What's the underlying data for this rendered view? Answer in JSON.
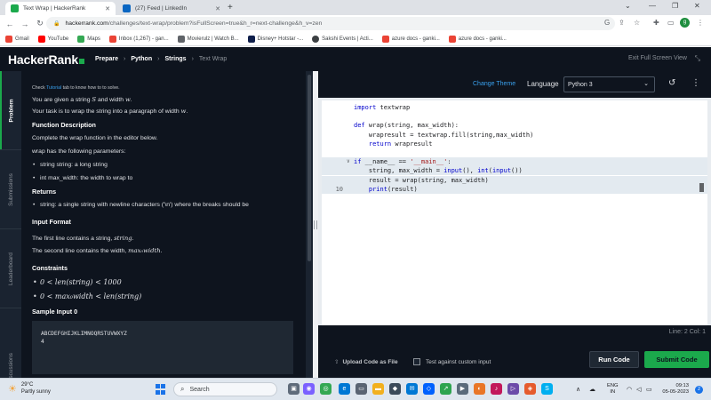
{
  "browser": {
    "tabs": [
      {
        "label": "Text Wrap | HackerRank",
        "active": true,
        "favicon_color": "#1ba94c"
      },
      {
        "label": "(27) Feed | LinkedIn",
        "active": false,
        "favicon_color": "#0a66c2"
      }
    ],
    "new_tab": "+",
    "url_host": "hackerrank.com",
    "url_path": "/challenges/text-wrap/problem?isFullScreen=true&h_r=next-challenge&h_v=zen",
    "profile_initial": "g",
    "bookmarks": [
      {
        "label": "Gmail",
        "color": "#ea4335"
      },
      {
        "label": "YouTube",
        "color": "#ff0000"
      },
      {
        "label": "Maps",
        "color": "#34a853"
      },
      {
        "label": "Inbox (1,267) - gan...",
        "color": "#ea4335"
      },
      {
        "label": "Movierulz | Watch B...",
        "color": "#5f6368"
      },
      {
        "label": "Disney+ Hotstar -...",
        "color": "#0f1f4b"
      },
      {
        "label": "Sakshi Events | Acti...",
        "color": "#3c4043"
      },
      {
        "label": "azure docs - ganki...",
        "color": "#ea4335"
      },
      {
        "label": "azure docs - ganki...",
        "color": "#ea4335"
      }
    ]
  },
  "header": {
    "logo": "HackerRank",
    "breadcrumbs": [
      "Prepare",
      "Python",
      "Strings",
      "Text Wrap"
    ],
    "exit_fullscreen": "Exit Full Screen View"
  },
  "side_tabs": [
    "Problem",
    "Submissions",
    "Leaderboard",
    "Discussions"
  ],
  "problem": {
    "tip_prefix": "Check ",
    "tip_link": "Tutorial",
    "tip_suffix": " tab to know how to to solve.",
    "intro1_prefix": "You are given a string ",
    "intro1_var1": "S",
    "intro1_mid": " and width ",
    "intro1_var2": "w",
    "intro1_suffix": ".",
    "intro2_prefix": "Your task is to wrap the string into a paragraph of width ",
    "intro2_var": "w",
    "intro2_suffix": ".",
    "func_desc_heading": "Function Description",
    "func_desc_text": "Complete the wrap function in the editor below.",
    "params_intro": "wrap has the following parameters:",
    "params": [
      "string string: a long string",
      "int max_width: the width to wrap to"
    ],
    "returns_heading": "Returns",
    "returns": [
      "string: a single string with newline characters ('\\n') where the breaks should be"
    ],
    "input_heading": "Input Format",
    "input_line1_prefix": "The first line contains a string, ",
    "input_line1_var": "string",
    "input_line1_suffix": ".",
    "input_line2_prefix": "The second line contains the width, ",
    "input_line2_var": "max₀width",
    "input_line2_suffix": ".",
    "constraints_heading": "Constraints",
    "constraints": [
      "0 < len(string) < 1000",
      "0 < max₀width < len(string)"
    ],
    "sample_heading": "Sample Input 0",
    "sample_lines": [
      "ABCDEFGHIJKLIMNOQRSTUVWXYZ",
      "4"
    ]
  },
  "editor": {
    "change_theme": "Change Theme",
    "language_label": "Language",
    "language_value": "Python 3",
    "code_lines": [
      {
        "n": "",
        "fold": "",
        "html": "<span class='kw'>import</span> textwrap",
        "hl": false
      },
      {
        "n": "",
        "fold": "",
        "html": "",
        "hl": false
      },
      {
        "n": "",
        "fold": "",
        "html": "<span class='kw'>def</span> wrap(string, max_width):",
        "hl": false
      },
      {
        "n": "",
        "fold": "",
        "html": "    wrapresult = textwrap.fill(string,max_width)",
        "hl": false
      },
      {
        "n": "",
        "fold": "",
        "html": "    <span class='kw'>return</span> wrapresult",
        "hl": false
      },
      {
        "n": "",
        "fold": "",
        "html": "",
        "hl": false
      },
      {
        "n": "",
        "fold": "∨",
        "html": "<span class='kw'>if</span> __name__ == <span class='str'>'__main__'</span>:",
        "hl": true
      },
      {
        "n": "",
        "fold": "",
        "html": "    string, max_width = <span class='fn'>input</span>(), <span class='fn'>int</span>(<span class='fn'>input</span>())",
        "hl": true
      },
      {
        "n": "",
        "fold": "",
        "html": "    result = wrap(string, max_width)",
        "hl": true
      },
      {
        "n": "10",
        "fold": "",
        "html": "    <span class='fn'>print</span>(result)",
        "hl": true
      }
    ],
    "status": "Line: 2 Col: 1",
    "upload_label": "Upload Code as File",
    "custom_input_label": "Test against custom input",
    "run_label": "Run Code",
    "submit_label": "Submit Code"
  },
  "taskbar": {
    "temperature": "29°C",
    "weather": "Partly sunny",
    "search_placeholder": "Search",
    "lang_line1": "ENG",
    "lang_line2": "IN",
    "time": "09:13",
    "date": "05-05-2023",
    "notification_count": "2"
  }
}
